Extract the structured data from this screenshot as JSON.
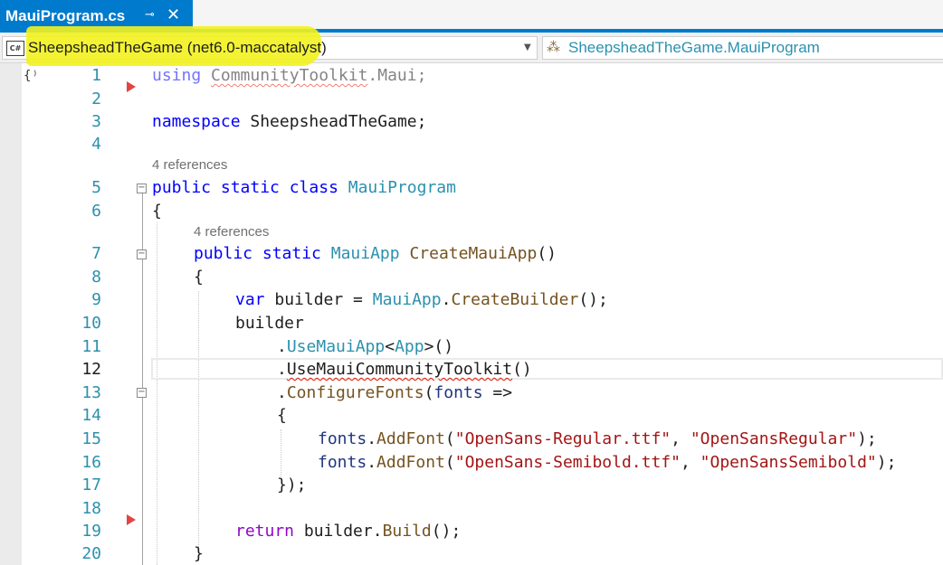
{
  "tab": {
    "title": "MauiProgram.cs",
    "pin_glyph": "⊸",
    "close_glyph": "✕"
  },
  "navbar": {
    "project_icon": "C#",
    "project": "SheepsheadTheGame (net6.0-maccatalyst)",
    "type_member": "SheepsheadTheGame.MauiProgram",
    "highlight_color": "#f2f21e"
  },
  "glyph_margin": "{⁾",
  "line_numbers": [
    "1",
    "2",
    "3",
    "4",
    "5",
    "6",
    "7",
    "8",
    "9",
    "10",
    "11",
    "12",
    "13",
    "14",
    "15",
    "16",
    "17",
    "18",
    "19",
    "20"
  ],
  "current_line": "12",
  "codelens": {
    "class_refs": "4 references",
    "method_refs": "4 references"
  },
  "code": {
    "l1": {
      "using": "using",
      "ns": "CommunityToolkit",
      "dot": ".Maui;"
    },
    "l3": {
      "namespace": "namespace",
      "name": " SheepsheadTheGame;"
    },
    "l5": {
      "kw": "public static class",
      "name": "MauiProgram"
    },
    "l6": "{",
    "l7": {
      "kw": "public static",
      "type": "MauiApp",
      "method": "CreateMauiApp",
      "rest": "()"
    },
    "l8": "{",
    "l9": {
      "var": "var",
      "builder": " builder = ",
      "type": "MauiApp",
      "dot": ".",
      "method": "CreateBuilder",
      "rest": "();"
    },
    "l10": "builder",
    "l11": {
      "dot": ".",
      "method": "UseMauiApp",
      "lt": "<",
      "type": "App",
      "rest": ">()"
    },
    "l12": {
      "dot": ".",
      "method": "UseMauiCommunityToolkit",
      "rest": "()"
    },
    "l13": {
      "dot": ".",
      "method": "ConfigureFonts",
      "open": "(",
      "param": "fonts",
      "arrow": " =>"
    },
    "l14": "{",
    "l15": {
      "param": "fonts",
      "dot": ".",
      "method": "AddFont",
      "open": "(",
      "s1": "\"OpenSans-Regular.ttf\"",
      "comma": ", ",
      "s2": "\"OpenSansRegular\"",
      "close": ");"
    },
    "l16": {
      "param": "fonts",
      "dot": ".",
      "method": "AddFont",
      "open": "(",
      "s1": "\"OpenSans-Semibold.ttf\"",
      "comma": ", ",
      "s2": "\"OpenSansSemibold\"",
      "close": ");"
    },
    "l17": "});",
    "l19": {
      "return": "return",
      "builder": " builder.",
      "method": "Build",
      "rest": "();"
    },
    "l20": "}"
  },
  "colors": {
    "keyword": "#0000ff",
    "control_keyword": "#8f08c4",
    "type": "#2b91af",
    "method": "#74531f",
    "string": "#a31515",
    "parameter": "#1f377f",
    "line_number": "#2b91af",
    "tab_accent": "#007acc",
    "breakpoint_marker": "#e24444"
  },
  "icons": {
    "tab_pin": "pin-icon",
    "tab_close": "close-icon",
    "project": "csharp-project-icon",
    "dropdown": "chevron-down-icon",
    "type": "class-icon",
    "breakpoint": "breakpoint-arrow-icon",
    "collapse": "collapse-icon"
  }
}
